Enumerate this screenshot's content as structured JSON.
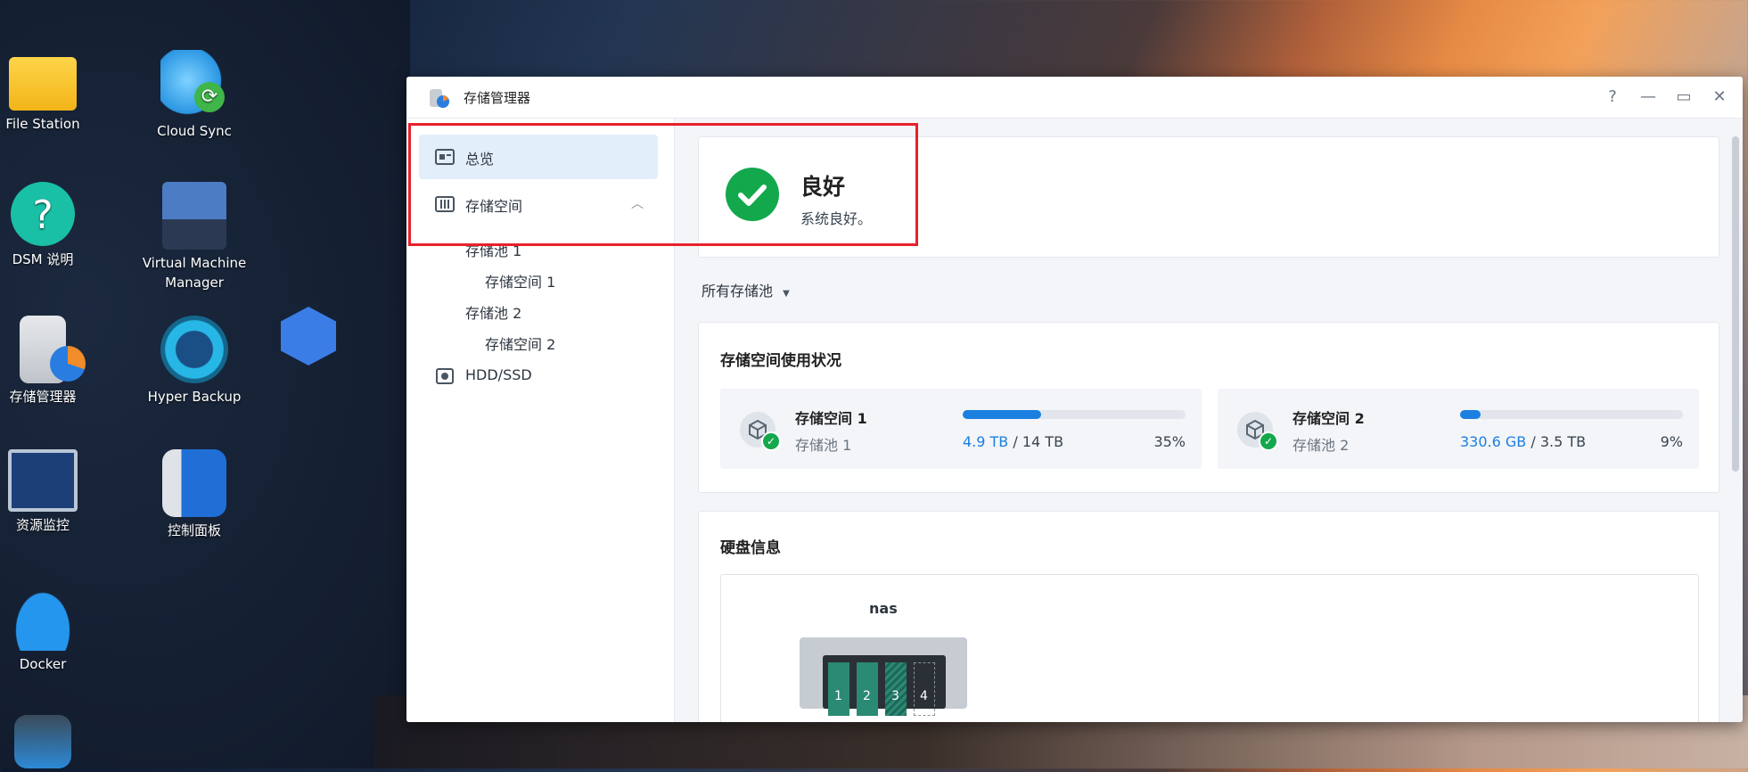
{
  "desktop": {
    "icons": [
      {
        "label": "File Station"
      },
      {
        "label": "Cloud Sync"
      },
      {
        "label": "DSM 说明"
      },
      {
        "label": "Virtual Machine Manager"
      },
      {
        "label": "存储管理器"
      },
      {
        "label": "Hyper Backup"
      },
      {
        "label": "资源监控"
      },
      {
        "label": "控制面板"
      },
      {
        "label": "Docker"
      }
    ]
  },
  "window": {
    "title": "存储管理器",
    "controls": {
      "help": "?",
      "minimize": "—",
      "maximize": "▭",
      "close": "✕"
    }
  },
  "sidebar": {
    "overview": "总览",
    "storage": "存储空间",
    "pool1": "存储池 1",
    "volume1": "存储空间 1",
    "pool2": "存储池 2",
    "volume2": "存储空间 2",
    "hdd": "HDD/SSD"
  },
  "status": {
    "title": "良好",
    "desc": "系统良好。"
  },
  "filter": {
    "label": "所有存储池"
  },
  "usage": {
    "heading": "存储空间使用状况",
    "volumes": [
      {
        "name": "存储空间 1",
        "pool": "存储池 1",
        "used": "4.9 TB",
        "sep": " / ",
        "total": "14 TB",
        "percent": "35%",
        "fraction": 0.35
      },
      {
        "name": "存储空间 2",
        "pool": "存储池 2",
        "used": "330.6 GB",
        "sep": " / ",
        "total": "3.5 TB",
        "percent": "9%",
        "fraction": 0.09
      }
    ]
  },
  "disk": {
    "heading": "硬盘信息",
    "device": "nas",
    "bays": [
      "1",
      "2",
      "3",
      "4"
    ]
  },
  "colors": {
    "accent": "#1b7fe0",
    "success": "#14a84d",
    "highlight": "#e8212b"
  }
}
